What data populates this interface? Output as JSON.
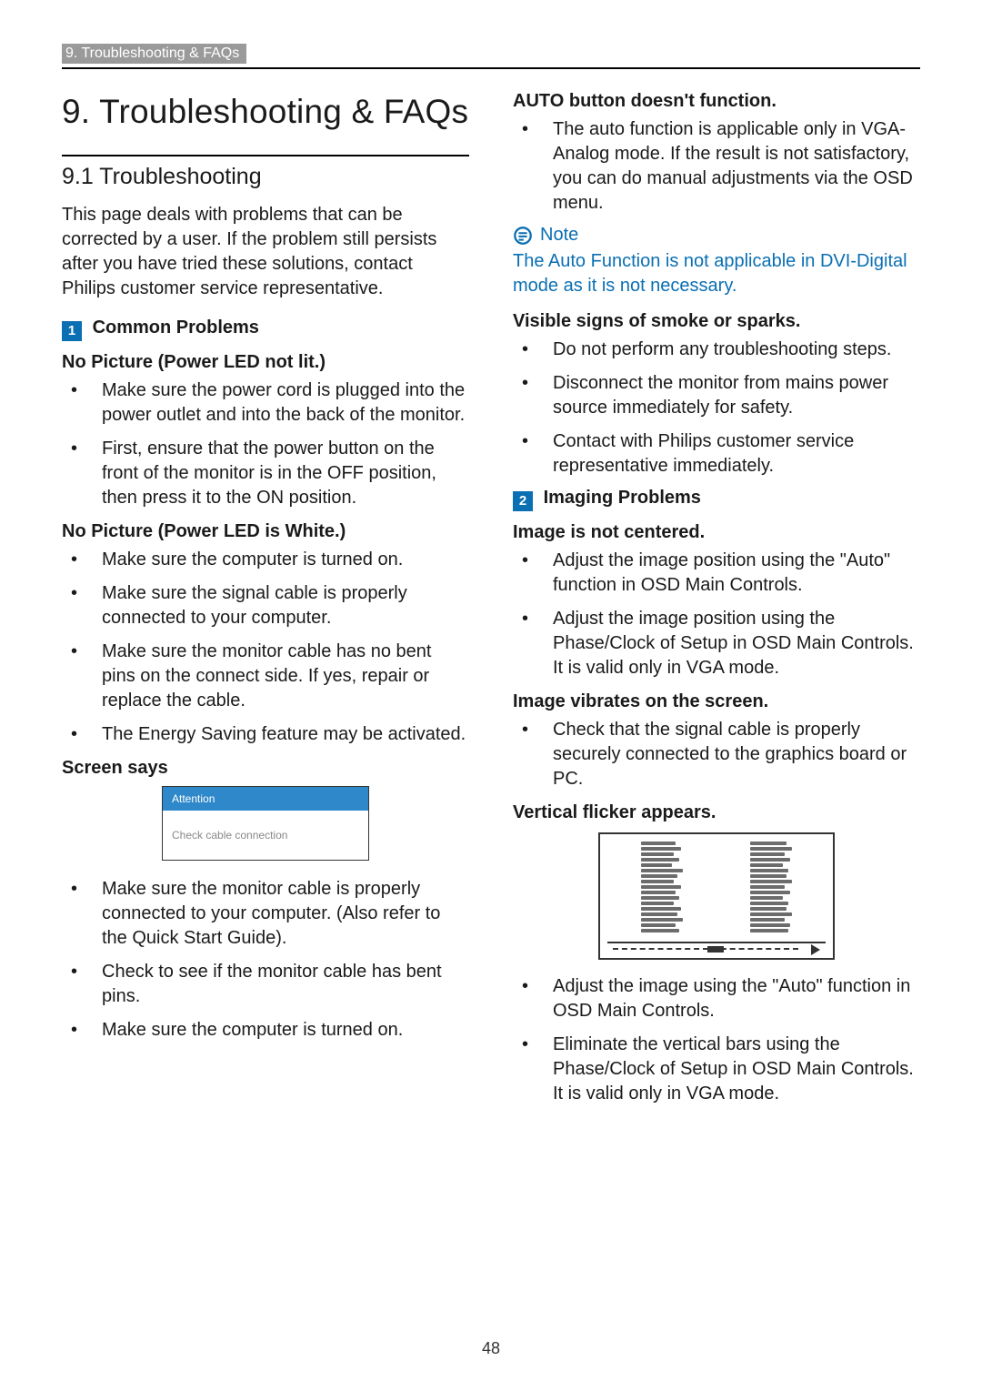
{
  "header": {
    "breadcrumb": "9. Troubleshooting & FAQs"
  },
  "pageNumber": "48",
  "left": {
    "title": "9.  Troubleshooting & FAQs",
    "sectionTitle": "9.1  Troubleshooting",
    "intro": "This page deals with problems that can be corrected by a user. If the problem still persists after you have tried these solutions, contact Philips customer service representative.",
    "group1": {
      "num": "1",
      "title": "Common Problems"
    },
    "h1": "No Picture (Power LED not lit.)",
    "l1": [
      "Make sure the power cord is plugged into the power outlet and into the back of the monitor.",
      "First, ensure that the power button on the front of the monitor is in the OFF position, then press it to the ON position."
    ],
    "h2": "No Picture (Power LED is White.)",
    "l2": [
      "Make sure the computer is turned on.",
      "Make sure the signal cable is properly connected to your computer.",
      "Make sure the monitor cable has no bent pins on the connect side. If yes, repair or replace the cable.",
      "The Energy Saving feature may be activated."
    ],
    "h3": "Screen says",
    "attention": {
      "head": "Attention",
      "body": "Check cable connection"
    },
    "l3": [
      "Make sure the monitor cable is properly connected to your computer. (Also refer to the Quick Start Guide).",
      "Check to see if the monitor cable has bent pins.",
      "Make sure the computer is turned on."
    ]
  },
  "right": {
    "h1": "AUTO button doesn't function.",
    "l1": [
      "The auto function is applicable only in VGA-Analog mode.  If the result is not satisfactory, you can do manual adjustments via the OSD menu."
    ],
    "noteLabel": "Note",
    "noteText": "The Auto Function is not applicable in DVI-Digital mode as it is not necessary.",
    "h2": "Visible signs of smoke or sparks.",
    "l2": [
      "Do not perform any troubleshooting steps.",
      "Disconnect the monitor from mains power source immediately for safety.",
      "Contact with Philips customer service representative immediately."
    ],
    "group2": {
      "num": "2",
      "title": "Imaging Problems"
    },
    "h3": "Image is not centered.",
    "l3": [
      "Adjust the image position using the \"Auto\" function in OSD Main Controls.",
      "Adjust the image position using the Phase/Clock of Setup in OSD Main Controls.  It is valid only in VGA mode."
    ],
    "h4": "Image vibrates on the screen.",
    "l4": [
      "Check that the signal cable is properly securely connected to the graphics board or PC."
    ],
    "h5": "Vertical flicker appears.",
    "l5": [
      "Adjust the image using the \"Auto\" function in OSD Main Controls.",
      "Eliminate the vertical bars using the Phase/Clock of Setup in OSD Main Controls. It is valid only in VGA mode."
    ]
  }
}
